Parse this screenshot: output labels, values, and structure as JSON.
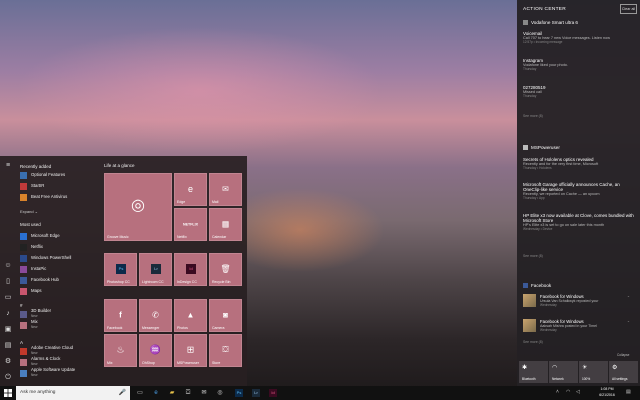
{
  "start_menu": {
    "recently_added_label": "Recently added",
    "recently_added": [
      "Optional Features",
      "StartIR",
      "Beat Free Antivirus"
    ],
    "expand_label": "Expand ⌄",
    "most_used_label": "Most used",
    "most_used": [
      "Microsoft Edge",
      "Netflix",
      "Windows PowerShell",
      "InstaPic",
      "Facebook Hub",
      "Maps"
    ],
    "hash_label": "#",
    "hash_apps": [
      {
        "name": "3D Builder",
        "sub": "New"
      },
      {
        "name": "Mix",
        "sub": "New"
      }
    ],
    "a_label": "A",
    "a_apps": [
      {
        "name": "Adobe Creative Cloud",
        "sub": "New"
      },
      {
        "name": "Alarms & Clock",
        "sub": "New"
      },
      {
        "name": "Apple Software Update",
        "sub": "New"
      }
    ],
    "tiles_group": "Life at a glance",
    "tiles": {
      "groove": "Groove Music",
      "edge": "Edge",
      "mail": "Mail",
      "netflix": "Netflix",
      "netflix_glyph": "NETFLIX",
      "calendar": "Calendar",
      "photoshop": "Photoshop CC",
      "lightroom": "Lightroom CC",
      "indesign": "InDesign CC",
      "recycle": "Recycle Bin",
      "facebook": "Facebook",
      "messenger": "Messenger",
      "photos": "Photos",
      "camera": "Camera",
      "mix": "Mix",
      "ohshop": "OhShop",
      "mspoweruser": "MSPoweruser",
      "store": "Store"
    }
  },
  "action_center": {
    "title": "ACTION CENTER",
    "clear_all": "Clear all",
    "device_group": "Vodafone Smart ultra 6",
    "device_notes": [
      {
        "title": "Voicemail",
        "body": "Call 707 to hear 7 new Voice messages. Listen now",
        "meta": "12:57p • Incoming message"
      },
      {
        "title": "Instagram",
        "body": "Vodafone liked your photo.",
        "meta": "Thursday"
      },
      {
        "title": "027280519",
        "body": "Missed call",
        "meta": "Thursday"
      }
    ],
    "see_more_1": "See more (8)",
    "mspu_group": "MSPoweruser",
    "mspu_notes": [
      {
        "title": "Secrets of Hololens optics revealed",
        "body": "Recently and for the very first time, Microsoft",
        "meta": "Thursday • Hololens"
      },
      {
        "title": "Microsoft Garage officially announces Cache, an OneClip-like service",
        "body": "Recently, we reported on Cache — an upcom",
        "meta": "Thursday • App"
      },
      {
        "title": "HP Elite x3 now available at Clove, comes bundled with Microsoft Store",
        "body": "HP's Elite x3 is set to go on sale later this month",
        "meta": "Wednesday • Device"
      }
    ],
    "see_more_2": "See more (8)",
    "fb_group": "Facebook",
    "fb_notes": [
      {
        "title": "Facebook for Windows",
        "body": "Ursula Van Schalkwyk reposted your",
        "meta": "Wednesday"
      },
      {
        "title": "Facebook for Windows",
        "body": "Aaksah Mishra posted in your Timel",
        "meta": "Wednesday"
      }
    ],
    "see_more_3": "See more (8)",
    "collapse_label": "Collapse",
    "quick_actions": [
      {
        "label": "Bluetooth",
        "icon": "✱"
      },
      {
        "label": "Network",
        "icon": "◠"
      },
      {
        "label": "100%",
        "icon": "☀"
      },
      {
        "label": "All settings",
        "icon": "⚙"
      }
    ]
  },
  "taskbar": {
    "search_placeholder": "Ask me anything",
    "time": "1:08 PM",
    "date": "6/21/2016"
  },
  "colors": {
    "tile": "#b7707e",
    "start_bg": "#282022",
    "action_center_bg": "#242124",
    "taskbar_bg": "#111111"
  }
}
